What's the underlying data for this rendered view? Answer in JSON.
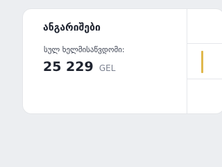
{
  "accounts": {
    "title": "ანგარიშები",
    "total_label": "სულ ხელმისაწვდომი:",
    "total_value": "25 229",
    "currency": "GEL"
  },
  "colors": {
    "background": "#eceef1",
    "card": "#ffffff",
    "accent": "#e0b84d"
  }
}
